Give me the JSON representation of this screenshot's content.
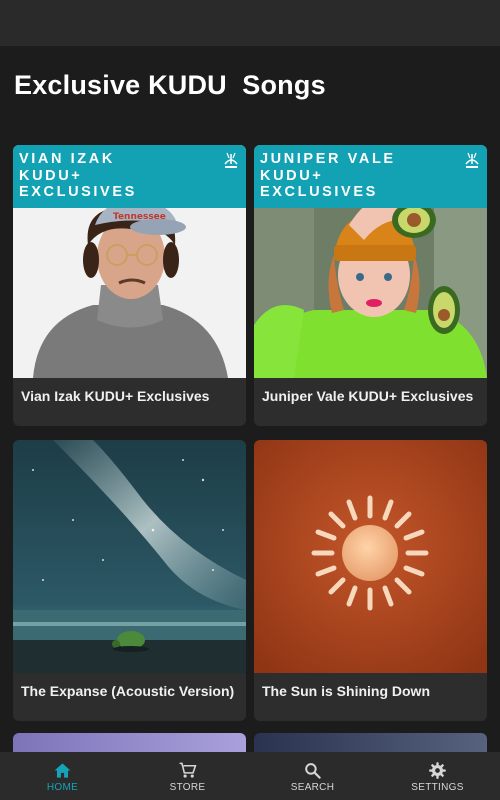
{
  "page": {
    "title": "Exclusive KUDU  Songs"
  },
  "cards": [
    {
      "banner": [
        "VIAN IZAK",
        "KUDU+",
        "EXCLUSIVES"
      ],
      "caption": "Vian Izak KUDU+ Exclusives"
    },
    {
      "banner": [
        "JUNIPER VALE",
        "KUDU+",
        "EXCLUSIVES"
      ],
      "caption": "Juniper Vale KUDU+ Exclusives"
    },
    {
      "caption": "The Expanse (Acoustic Version)"
    },
    {
      "caption": "The Sun is Shining Down"
    }
  ],
  "nav": {
    "items": [
      {
        "label": "HOME",
        "icon": "home-icon",
        "active": true
      },
      {
        "label": "STORE",
        "icon": "cart-icon",
        "active": false
      },
      {
        "label": "SEARCH",
        "icon": "search-icon",
        "active": false
      },
      {
        "label": "SETTINGS",
        "icon": "gear-icon",
        "active": false
      }
    ]
  },
  "colors": {
    "accent": "#17a2b8",
    "banner": "#13a2b3",
    "background": "#1c1c1c",
    "card": "#2d2d2d"
  }
}
